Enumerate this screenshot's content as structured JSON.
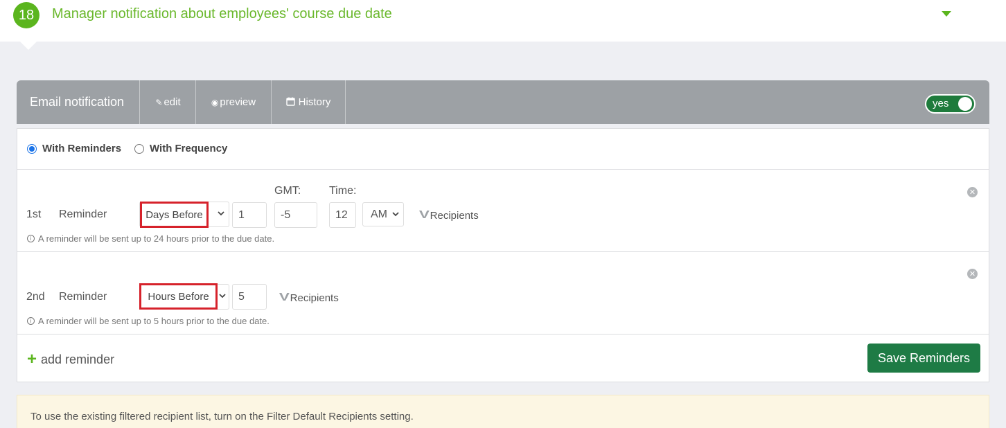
{
  "header": {
    "step_number": "18",
    "title": "Manager notification about employees' course due date",
    "icons": {
      "collapse": "caret-down-icon"
    }
  },
  "email_bar": {
    "title": "Email notification",
    "tabs": [
      {
        "label": "edit",
        "icon": "pencil-icon"
      },
      {
        "label": "preview",
        "icon": "eye-icon"
      },
      {
        "label": "History",
        "icon": "calendar-icon"
      }
    ],
    "toggle_label": "yes",
    "toggle_on": true
  },
  "mode": {
    "options": [
      {
        "label": "With Reminders",
        "selected": true
      },
      {
        "label": "With Frequency",
        "selected": false
      }
    ]
  },
  "reminders": [
    {
      "ordinal": "1st",
      "label": "Reminder",
      "unit": "Days Before",
      "amount": "1",
      "gmt_label": "GMT:",
      "gmt": "-5",
      "time_label": "Time:",
      "hour": "12",
      "ampm": "AM",
      "recipients_label": "Recipients",
      "hint": "A reminder will be sent up to 24 hours prior to the due date."
    },
    {
      "ordinal": "2nd",
      "label": "Reminder",
      "unit": "Hours Before",
      "amount": "5",
      "recipients_label": "Recipients",
      "hint": "A reminder will be sent up to 5 hours prior to the due date."
    }
  ],
  "actions": {
    "add_reminder": "add reminder",
    "save": "Save Reminders"
  },
  "info": {
    "text": "To use the existing filtered recipient list, turn on the Filter Default Recipients setting."
  },
  "colors": {
    "accent_green": "#5bb51e",
    "save_green": "#1e7b45",
    "highlight_red": "#d6222b",
    "bar_gray": "#9da1a5"
  }
}
